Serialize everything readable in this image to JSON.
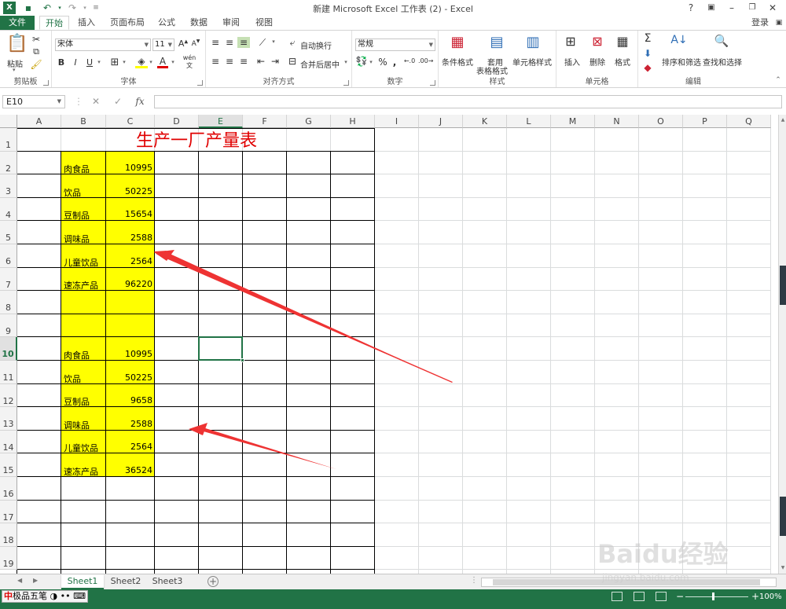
{
  "window": {
    "title": "新建 Microsoft Excel 工作表 (2) - Excel",
    "login": "登录",
    "help": "?"
  },
  "ribbon_tabs": [
    "文件",
    "开始",
    "插入",
    "页面布局",
    "公式",
    "数据",
    "审阅",
    "视图"
  ],
  "ribbon": {
    "clipboard": {
      "paste": "粘贴",
      "label": "剪贴板"
    },
    "font": {
      "name": "宋体",
      "size": "11",
      "bold": "B",
      "italic": "I",
      "underline": "U",
      "label": "字体",
      "phonetic": "wén"
    },
    "alignment": {
      "wrap": "自动换行",
      "merge": "合并后居中",
      "label": "对齐方式"
    },
    "number": {
      "format": "常规",
      "percent": "%",
      "comma": ",",
      "label": "数字"
    },
    "styles": {
      "conditional": "条件格式",
      "table_line1": "套用",
      "table_line2": "表格格式",
      "cell_styles": "单元格样式",
      "label": "样式"
    },
    "cells": {
      "insert": "插入",
      "delete": "删除",
      "format": "格式",
      "label": "单元格"
    },
    "editing": {
      "sort": "排序和筛选",
      "find": "查找和选择",
      "label": "编辑",
      "sigma": "Σ"
    }
  },
  "formula_bar": {
    "name_box": "E10",
    "fx": "fx",
    "formula": ""
  },
  "columns": [
    "A",
    "B",
    "C",
    "D",
    "E",
    "F",
    "G",
    "H",
    "I",
    "J",
    "K",
    "L",
    "M",
    "N",
    "O",
    "P",
    "Q"
  ],
  "rows": [
    "1",
    "2",
    "3",
    "4",
    "5",
    "6",
    "7",
    "8",
    "9",
    "10",
    "11",
    "12",
    "13",
    "14",
    "15",
    "16",
    "17",
    "18",
    "19"
  ],
  "active_cell": {
    "column": "E",
    "row": "10"
  },
  "sheet_title": "生产一厂产量表",
  "table_rows": [
    {
      "row": "2",
      "product": "肉食品",
      "qty": "10995"
    },
    {
      "row": "3",
      "product": "饮品",
      "qty": "50225"
    },
    {
      "row": "4",
      "product": "豆制品",
      "qty": "15654"
    },
    {
      "row": "5",
      "product": "调味品",
      "qty": "2588"
    },
    {
      "row": "6",
      "product": "儿童饮品",
      "qty": "2564"
    },
    {
      "row": "7",
      "product": "速冻产品",
      "qty": "96220"
    },
    {
      "row": "10",
      "product": "肉食品",
      "qty": "10995"
    },
    {
      "row": "11",
      "product": "饮品",
      "qty": "50225"
    },
    {
      "row": "12",
      "product": "豆制品",
      "qty": "9658"
    },
    {
      "row": "13",
      "product": "调味品",
      "qty": "2588"
    },
    {
      "row": "14",
      "product": "儿童饮品",
      "qty": "2564"
    },
    {
      "row": "15",
      "product": "速冻产品",
      "qty": "36524"
    }
  ],
  "sheets": [
    "Sheet1",
    "Sheet2",
    "Sheet3"
  ],
  "active_sheet": "Sheet1",
  "status": {
    "ime": "极品五笔",
    "ime_zh": "中",
    "zoom": "100%"
  },
  "colors": {
    "accent": "#217346",
    "highlight": "#ffff00",
    "title_red": "#e00000",
    "arrow_red": "#ee3333"
  },
  "watermark": {
    "main": "Baidu经验",
    "sub": "jingyan.baidu.com"
  }
}
